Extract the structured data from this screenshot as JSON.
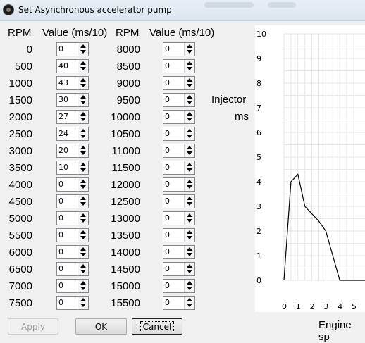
{
  "window": {
    "title": "Set Asynchronous accelerator pump"
  },
  "headers": {
    "rpm1": "RPM",
    "val1": "Value (ms/10)",
    "rpm2": "RPM",
    "val2": "Value (ms/10)"
  },
  "left_rows": [
    {
      "rpm": "0",
      "value": "0"
    },
    {
      "rpm": "500",
      "value": "40"
    },
    {
      "rpm": "1000",
      "value": "43"
    },
    {
      "rpm": "1500",
      "value": "30"
    },
    {
      "rpm": "2000",
      "value": "27"
    },
    {
      "rpm": "2500",
      "value": "24"
    },
    {
      "rpm": "3000",
      "value": "20"
    },
    {
      "rpm": "3500",
      "value": "10"
    },
    {
      "rpm": "4000",
      "value": "0"
    },
    {
      "rpm": "4500",
      "value": "0"
    },
    {
      "rpm": "5000",
      "value": "0"
    },
    {
      "rpm": "5500",
      "value": "0"
    },
    {
      "rpm": "6000",
      "value": "0"
    },
    {
      "rpm": "6500",
      "value": "0"
    },
    {
      "rpm": "7000",
      "value": "0"
    },
    {
      "rpm": "7500",
      "value": "0"
    }
  ],
  "right_rows": [
    {
      "rpm": "8000",
      "value": "0"
    },
    {
      "rpm": "8500",
      "value": "0"
    },
    {
      "rpm": "9000",
      "value": "0"
    },
    {
      "rpm": "9500",
      "value": "0"
    },
    {
      "rpm": "10000",
      "value": "0"
    },
    {
      "rpm": "10500",
      "value": "0"
    },
    {
      "rpm": "11000",
      "value": "0"
    },
    {
      "rpm": "11500",
      "value": "0"
    },
    {
      "rpm": "12000",
      "value": "0"
    },
    {
      "rpm": "12500",
      "value": "0"
    },
    {
      "rpm": "13000",
      "value": "0"
    },
    {
      "rpm": "13500",
      "value": "0"
    },
    {
      "rpm": "14000",
      "value": "0"
    },
    {
      "rpm": "14500",
      "value": "0"
    },
    {
      "rpm": "15000",
      "value": "0"
    },
    {
      "rpm": "15500",
      "value": "0"
    }
  ],
  "buttons": {
    "apply": "Apply",
    "ok": "OK",
    "cancel": "Cancel"
  },
  "chart_data": {
    "type": "line",
    "ylabel_line1": "Injector",
    "ylabel_line2": "ms",
    "xlabel": "Engine sp",
    "ylim": [
      0,
      10
    ],
    "y_ticks": [
      "0",
      "1",
      "2",
      "3",
      "4",
      "5",
      "6",
      "7",
      "8",
      "9",
      "10"
    ],
    "x_ticks": [
      "0",
      "1",
      "2",
      "3",
      "4",
      "5"
    ],
    "x": [
      0,
      0.5,
      1,
      1.5,
      2,
      2.5,
      3,
      3.5,
      4,
      4.5,
      5,
      5.5,
      6,
      6.5,
      7,
      7.5
    ],
    "series": [
      {
        "values": [
          0,
          4.0,
          4.3,
          3.0,
          2.7,
          2.4,
          2.0,
          1.0,
          0,
          0,
          0,
          0,
          0,
          0,
          0,
          0
        ]
      }
    ]
  }
}
